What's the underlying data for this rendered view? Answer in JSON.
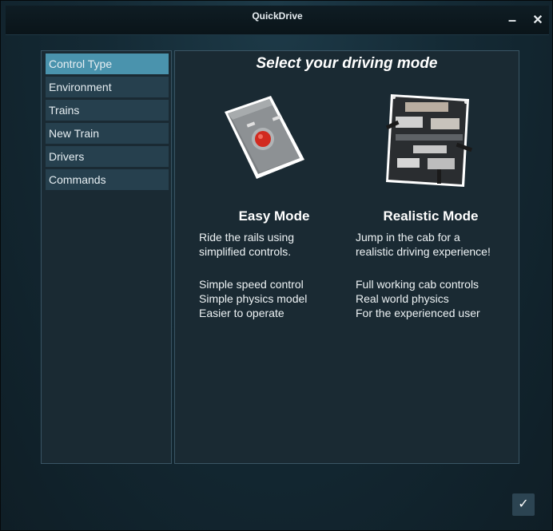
{
  "window": {
    "title": "QuickDrive"
  },
  "sidebar": {
    "items": [
      {
        "label": "Control Type",
        "active": true
      },
      {
        "label": "Environment",
        "active": false
      },
      {
        "label": "Trains",
        "active": false
      },
      {
        "label": "New Train",
        "active": false
      },
      {
        "label": "Drivers",
        "active": false
      },
      {
        "label": "Commands",
        "active": false
      }
    ]
  },
  "main": {
    "heading": "Select your driving mode",
    "modes": [
      {
        "title": "Easy Mode",
        "description": "Ride the rails using\nsimplified controls.",
        "features": [
          "Simple speed control",
          "Simple physics model",
          "Easier to operate"
        ],
        "icon": "simple-controller-icon"
      },
      {
        "title": "Realistic Mode",
        "description": "Jump in the cab for a\nrealistic driving experience!",
        "features": [
          "Full working cab controls",
          "Real world physics",
          "For the experienced user"
        ],
        "icon": "cab-controls-icon"
      }
    ]
  },
  "footer": {
    "confirm_icon": "checkmark-icon"
  },
  "colors": {
    "accent": "#4a93ad",
    "panel": "#1a2a33",
    "nav_item": "#26404e"
  }
}
